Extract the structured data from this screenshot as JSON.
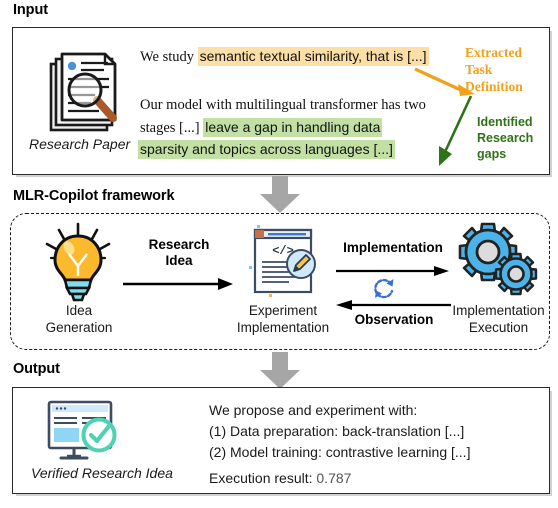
{
  "sections": {
    "input": {
      "heading": "Input"
    },
    "framework": {
      "heading": "MLR-Copilot framework"
    },
    "output": {
      "heading": "Output"
    }
  },
  "input": {
    "paper_icon_caption": "Research Paper",
    "paper_icon_name": "research-paper-icon",
    "sentence1_prefix": "We study ",
    "sentence1_highlight": "semantic textual similarity, that is  [...]",
    "sentence2_line1": "Our model with multilingual transformer has two",
    "sentence2_line2_prefix": "stages [...]  ",
    "sentence2_line2_highlight": "leave a gap in handling data",
    "sentence2_line3_highlight": "sparsity and topics  across languages [...]",
    "annotation_task": "Extracted\nTask\nDefinition",
    "annotation_task_lines": [
      "Extracted",
      "Task",
      "Definition"
    ],
    "annotation_gaps_lines": [
      "Identified",
      "Research",
      "gaps"
    ],
    "highlight_amber": "#FBDFA6",
    "highlight_green": "#C2E0A4",
    "annotation_amber_color": "#F2A11B",
    "annotation_green_color": "#2F7218"
  },
  "framework": {
    "nodes": [
      {
        "id": "idea-generation",
        "icon": "lightbulb-icon",
        "label_lines": [
          "Idea",
          "Generation"
        ]
      },
      {
        "id": "experiment-implementation",
        "icon": "code-document-icon",
        "label_lines": [
          "Experiment",
          "Implementation"
        ]
      },
      {
        "id": "implementation-execution",
        "icon": "gears-icon",
        "label_lines": [
          "Implementation",
          "Execution"
        ]
      }
    ],
    "edges": [
      {
        "id": "research-idea",
        "label_lines": [
          "Research",
          "Idea"
        ],
        "direction": "right"
      },
      {
        "id": "implementation",
        "label_lines": [
          "Implementation"
        ],
        "direction": "right"
      },
      {
        "id": "observation",
        "label_lines": [
          "Observation"
        ],
        "direction": "left",
        "icon": "refresh-loop-icon"
      }
    ],
    "colors": {
      "bulb": "#FDB92E",
      "bulb_base": "#7FDEED",
      "gear": "#4BB3E8",
      "gear_center": "#DCDCDC",
      "loop": "#3A6FD8"
    }
  },
  "output": {
    "icon_name": "verified-monitor-icon",
    "icon_caption": "Verified Research Idea",
    "line1": "We propose and experiment with:",
    "line2": "(1) Data preparation: back-translation [...]",
    "line3": "(2) Model training: contrastive learning [...]",
    "result_label": "Execution result: ",
    "result_value": "0.787",
    "check_color": "#4FD1B4",
    "screen_color": "#8FD5F4"
  },
  "connectors": {
    "arrow_color": "#A6A6A6",
    "count": 2
  }
}
